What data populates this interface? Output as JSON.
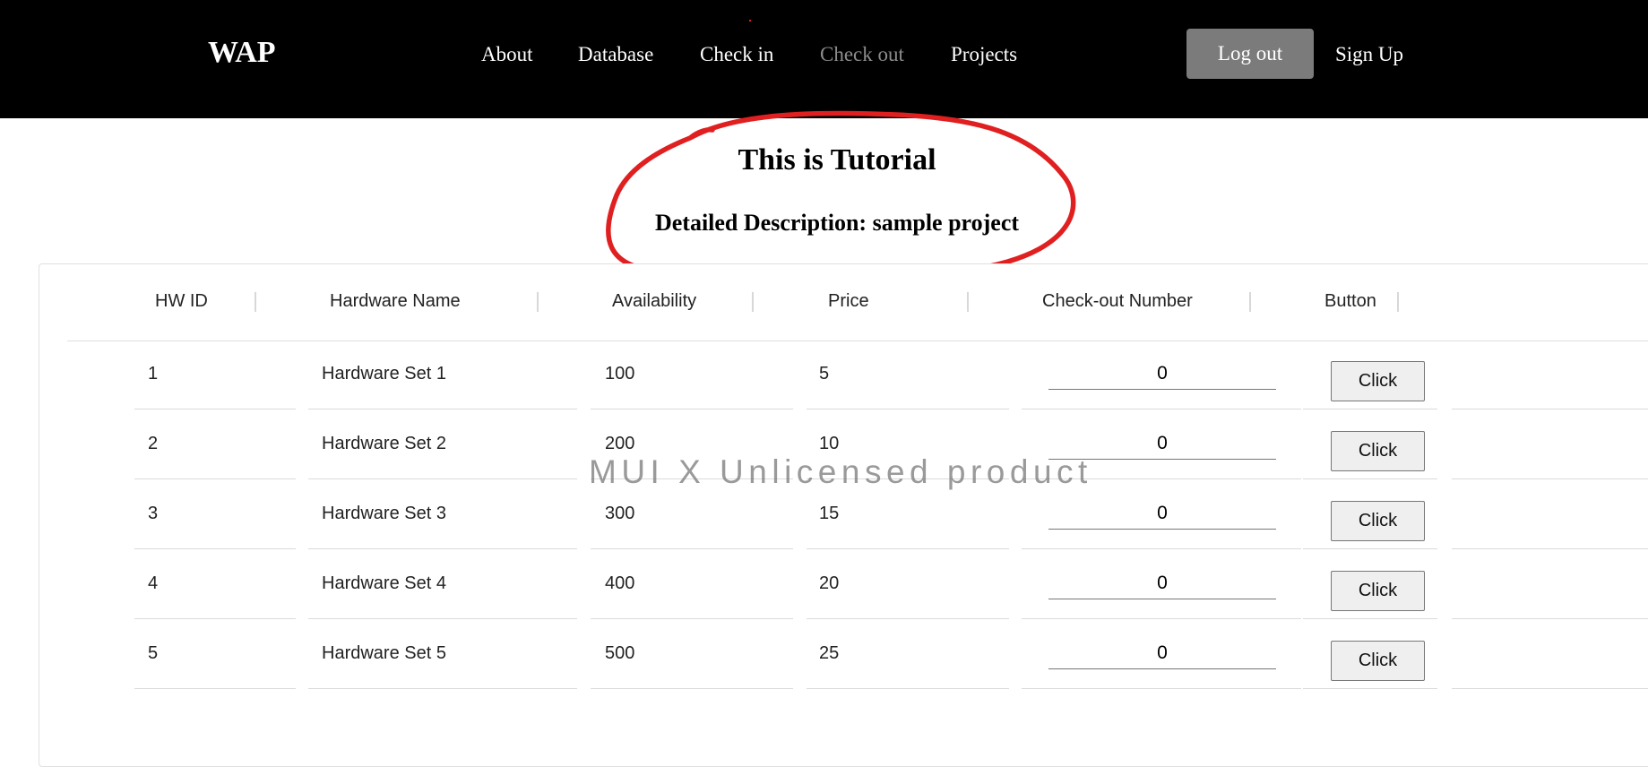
{
  "navbar": {
    "brand": "WAP",
    "links": [
      "About",
      "Database",
      "Check in",
      "Check out",
      "Projects"
    ],
    "logout": "Log out",
    "signup": "Sign Up"
  },
  "project": {
    "title": "This is Tutorial",
    "description": "Detailed Description: sample project"
  },
  "table": {
    "columns": [
      "HW ID",
      "Hardware Name",
      "Availability",
      "Price",
      "Check-out Number",
      "Button"
    ],
    "rows": [
      {
        "id": "1",
        "name": "Hardware Set 1",
        "availability": "100",
        "price": "5",
        "checkout": "0",
        "button": "Click"
      },
      {
        "id": "2",
        "name": "Hardware Set 2",
        "availability": "200",
        "price": "10",
        "checkout": "0",
        "button": "Click"
      },
      {
        "id": "3",
        "name": "Hardware Set 3",
        "availability": "300",
        "price": "15",
        "checkout": "0",
        "button": "Click"
      },
      {
        "id": "4",
        "name": "Hardware Set 4",
        "availability": "400",
        "price": "20",
        "checkout": "0",
        "button": "Click"
      },
      {
        "id": "5",
        "name": "Hardware Set 5",
        "availability": "500",
        "price": "25",
        "checkout": "0",
        "button": "Click"
      }
    ]
  },
  "watermark": "MUI X Unlicensed product",
  "colors": {
    "navbar_bg": "#000000",
    "logout_bg": "#7b7b7b",
    "active_link": "#8c8c8c",
    "annotation": "#e02020"
  }
}
